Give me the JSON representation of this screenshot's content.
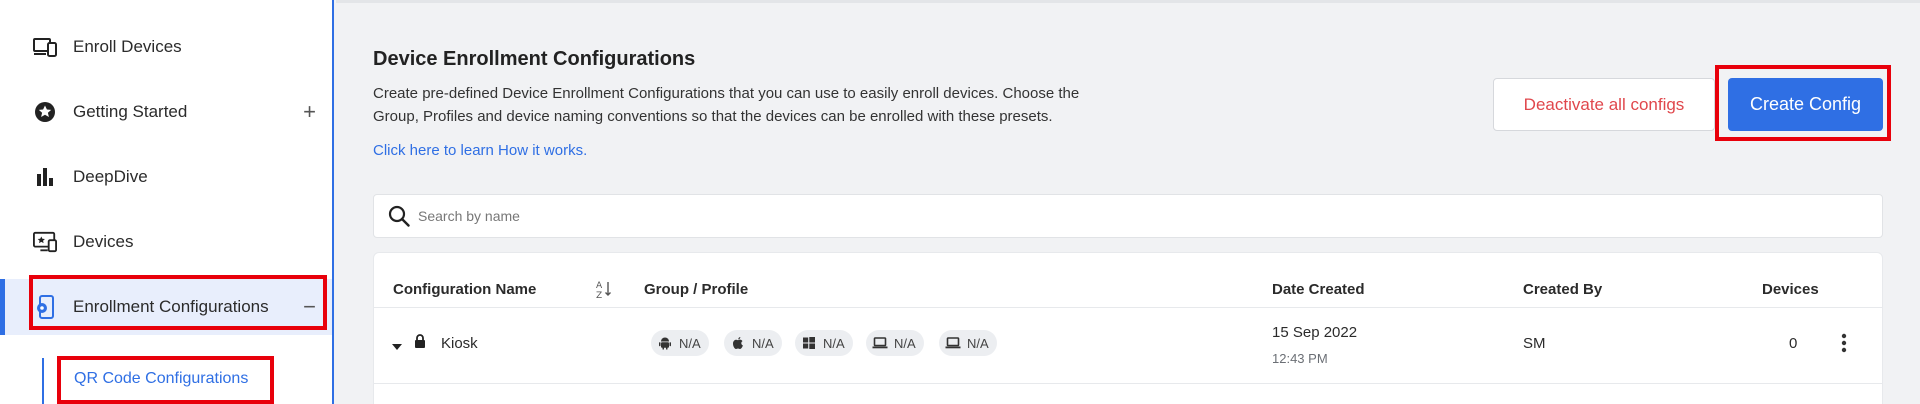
{
  "sidebar": {
    "items": [
      {
        "label": "Enroll Devices",
        "icon": "devices-icon"
      },
      {
        "label": "Getting Started",
        "icon": "star-badge-icon",
        "action": "+"
      },
      {
        "label": "DeepDive",
        "icon": "bar-chart-icon"
      },
      {
        "label": "Devices",
        "icon": "monitor-star-icon"
      },
      {
        "label": "Enrollment Configurations",
        "icon": "enrollment-config-icon",
        "action": "−"
      }
    ],
    "sub_items": [
      {
        "label": "QR Code Configurations"
      }
    ]
  },
  "header": {
    "title": "Device Enrollment Configurations",
    "description": "Create pre-defined Device Enrollment Configurations that you can use to easily enroll devices. Choose the Group, Profiles and device naming conventions so that the devices can be enrolled with these presets.",
    "learn_link": "Click here to learn How it works."
  },
  "buttons": {
    "deactivate": "Deactivate all configs",
    "create": "Create Config"
  },
  "search": {
    "placeholder": "Search by name"
  },
  "table": {
    "columns": {
      "name": "Configuration Name",
      "group_profile": "Group / Profile",
      "date_created": "Date Created",
      "created_by": "Created By",
      "devices": "Devices"
    },
    "rows": [
      {
        "name": "Kiosk",
        "profiles": [
          {
            "platform": "android-icon",
            "value": "N/A"
          },
          {
            "platform": "apple-icon",
            "value": "N/A"
          },
          {
            "platform": "windows-icon",
            "value": "N/A"
          },
          {
            "platform": "laptop-icon",
            "value": "N/A"
          },
          {
            "platform": "chromebook-icon",
            "value": "N/A"
          }
        ],
        "date": "15 Sep 2022",
        "time": "12:43 PM",
        "created_by": "SM",
        "devices": "0"
      }
    ]
  },
  "colors": {
    "accent": "#2f6fe4",
    "danger": "#e0474c",
    "highlight_box": "#e8000b"
  }
}
